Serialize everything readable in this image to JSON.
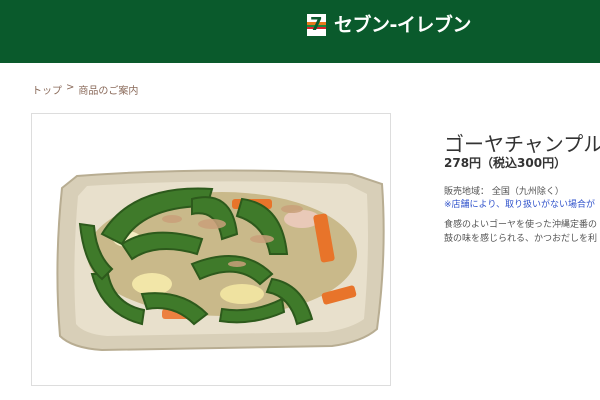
{
  "header": {
    "brand_name": "セブン-イレブン",
    "logo_numeral": "7",
    "bg_color": "#0a5a2c"
  },
  "breadcrumb": {
    "top": "トップ",
    "separator": ">",
    "current": "商品のご案内"
  },
  "product": {
    "image_icon": "food-photo-goya-chanpuru",
    "title": "ゴーヤチャンプル",
    "price": "278円（税込300円）",
    "region": "販売地域：  全国（九州除く）",
    "notice": "※店舗により、取り扱いがない場合が",
    "description_lines": [
      "食感のよいゴーヤを使った沖縄定番の",
      "鼓の味を感じられる、かつおだしを利"
    ]
  }
}
